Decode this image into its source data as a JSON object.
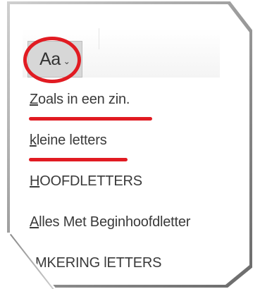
{
  "ribbon": {
    "change_case_button": {
      "label": "Aa",
      "chevron_icon": "chevron-down-icon"
    }
  },
  "menu": {
    "items": [
      {
        "first": "Z",
        "rest": "oals in een zin."
      },
      {
        "first": "k",
        "rest": "leine letters"
      },
      {
        "first": "H",
        "rest": "OOFDLETTERS"
      },
      {
        "first": "A",
        "rest": "lles Met Beginhoofdletter"
      },
      {
        "first": "",
        "rest": "MKERING lETTERS"
      }
    ]
  },
  "annotation": {
    "highlight_color": "#e11b22"
  }
}
